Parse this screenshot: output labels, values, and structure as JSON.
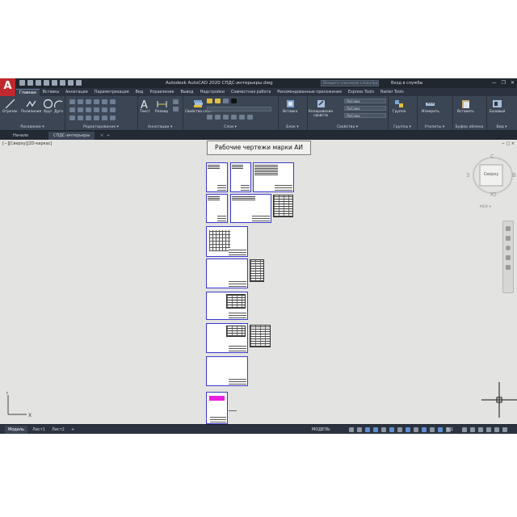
{
  "app": {
    "logo": "A",
    "title": "Autodesk AutoCAD 2020   СПДС-интерьеры.dwg",
    "search_placeholder": "Введите ключевое слово/фразу",
    "sign_in": "Вход в службы",
    "window_controls": [
      "—",
      "❐",
      "✕"
    ]
  },
  "ribbon_tabs": [
    {
      "label": "Главная",
      "active": true
    },
    {
      "label": "Вставка"
    },
    {
      "label": "Аннотации"
    },
    {
      "label": "Параметризация"
    },
    {
      "label": "Вид"
    },
    {
      "label": "Управление"
    },
    {
      "label": "Вывод"
    },
    {
      "label": "Надстройки"
    },
    {
      "label": "Совместная работа"
    },
    {
      "label": "Рекомендованные приложения"
    },
    {
      "label": "Express Tools"
    },
    {
      "label": "Raster Tools"
    }
  ],
  "ribbon_groups": {
    "draw": {
      "label": "Рисование ▾",
      "tools": [
        "Отрезок",
        "Полилиния",
        "Круг",
        "Дуга"
      ]
    },
    "modify": {
      "label": "Редактирование ▾"
    },
    "annotation": {
      "label": "Аннотации ▾",
      "tools": [
        "Текст",
        "Размер"
      ]
    },
    "layers": {
      "label": "Слои ▾",
      "tools": [
        "Свойства слоя"
      ]
    },
    "block": {
      "label": "Блок ▾",
      "tools": [
        "Вставка"
      ]
    },
    "properties": {
      "label": "Свойства ▾",
      "tools": [
        "Копирование свойств"
      ],
      "dropdowns": [
        "ПоСлою",
        "ПоСлою",
        "ПоСлою"
      ]
    },
    "groups": {
      "label": "Группы ▾",
      "tools": [
        "Группа"
      ]
    },
    "utilities": {
      "label": "Утилиты ▾",
      "tools": [
        "Измерить"
      ]
    },
    "clipboard": {
      "label": "Буфер обмена",
      "tools": [
        "Вставить"
      ]
    },
    "view": {
      "label": "Вид ▾",
      "tools": [
        "Базовый"
      ]
    }
  },
  "file_tabs": [
    {
      "label": "Начало"
    },
    {
      "label": "СПДС-интерьеры",
      "active": true
    }
  ],
  "viewport": {
    "label": "[−][Сверху][2D-каркас]",
    "controls": "− □ ×"
  },
  "drawing": {
    "title_text": "Рабочие чертежи марки АИ"
  },
  "viewcube": {
    "top_face": "Сверху",
    "north": "С",
    "south": "Ю",
    "west": "З",
    "east": "В",
    "wcs": "МСК ▾"
  },
  "layout_tabs": [
    {
      "label": "Модель",
      "active": true
    },
    {
      "label": "Лист1"
    },
    {
      "label": "Лист2"
    },
    {
      "label": "+"
    }
  ],
  "status": {
    "model": "МОДЕЛЬ",
    "scale": "1:1"
  },
  "colors": {
    "ribbon_bg": "#3b4554",
    "title_bg": "#21272f",
    "canvas_bg": "#e3e3e1",
    "sheet_border": "#3a3acc",
    "logo_red": "#c0282d",
    "highlight_magenta": "#e81ee0"
  }
}
